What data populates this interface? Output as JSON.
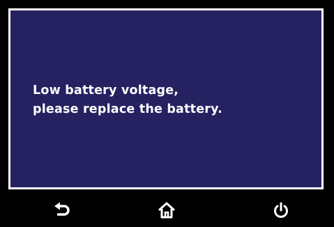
{
  "message": {
    "line1": "Low battery voltage,",
    "line2": "please replace the battery."
  },
  "navbar": {
    "buttons": [
      {
        "icon": "back-arrow-icon"
      },
      {
        "icon": "home-icon"
      },
      {
        "icon": "power-icon"
      }
    ]
  },
  "colors": {
    "background": "#000000",
    "screen": "#262262",
    "border": "#ffffff",
    "text": "#ffffff",
    "icon": "#ffffff"
  }
}
